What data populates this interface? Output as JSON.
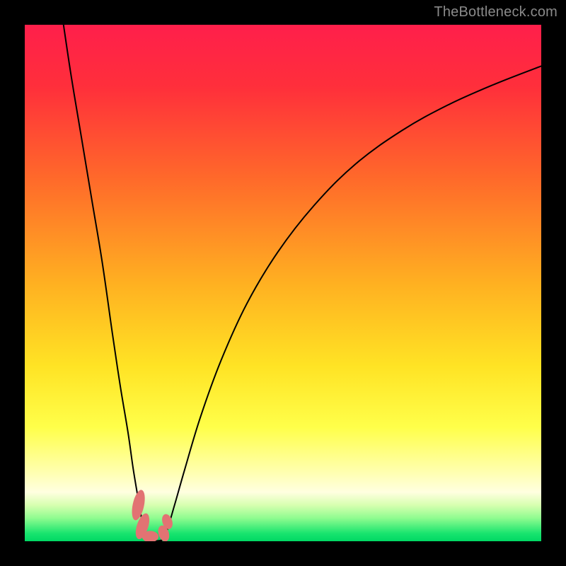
{
  "watermark": "TheBottleneck.com",
  "chart_data": {
    "type": "line",
    "title": "",
    "xlabel": "",
    "ylabel": "",
    "xlim": [
      0,
      100
    ],
    "ylim": [
      0,
      100
    ],
    "gradient_stops": [
      {
        "offset": 0.0,
        "color": "#ff1f4b"
      },
      {
        "offset": 0.12,
        "color": "#ff2f3b"
      },
      {
        "offset": 0.3,
        "color": "#ff6a2a"
      },
      {
        "offset": 0.5,
        "color": "#ffb021"
      },
      {
        "offset": 0.66,
        "color": "#ffe324"
      },
      {
        "offset": 0.78,
        "color": "#ffff4a"
      },
      {
        "offset": 0.86,
        "color": "#ffffa8"
      },
      {
        "offset": 0.905,
        "color": "#ffffe0"
      },
      {
        "offset": 0.93,
        "color": "#d7ffb0"
      },
      {
        "offset": 0.955,
        "color": "#90fc90"
      },
      {
        "offset": 0.985,
        "color": "#18e46e"
      },
      {
        "offset": 1.0,
        "color": "#00d864"
      }
    ],
    "series": [
      {
        "name": "left-curve",
        "x": [
          7.5,
          9,
          11,
          13,
          15,
          17,
          18.5,
          20,
          21,
          22,
          22.7,
          23.2,
          23.6,
          23.8
        ],
        "y": [
          100,
          90,
          78,
          66,
          54,
          40,
          30,
          21,
          14,
          8,
          4,
          2,
          0.8,
          0.2
        ]
      },
      {
        "name": "right-curve",
        "x": [
          26.5,
          27.5,
          29,
          31,
          34,
          38,
          43,
          49,
          56,
          64,
          73,
          82,
          91,
          100
        ],
        "y": [
          0.2,
          2,
          7,
          14,
          24,
          35,
          46,
          56,
          65,
          73,
          79.5,
          84.5,
          88.5,
          92
        ]
      },
      {
        "name": "valley-floor",
        "x": [
          23.8,
          24.5,
          25.3,
          26.0,
          26.5
        ],
        "y": [
          0.2,
          0.05,
          0.05,
          0.1,
          0.2
        ]
      }
    ],
    "markers": [
      {
        "name": "left-blob-1",
        "cx": 22.0,
        "cy": 7.0,
        "rx": 1.1,
        "ry": 3.0,
        "rot": 12
      },
      {
        "name": "left-blob-2",
        "cx": 22.8,
        "cy": 2.9,
        "rx": 1.1,
        "ry": 2.6,
        "rot": 18
      },
      {
        "name": "left-blob-3",
        "cx": 24.3,
        "cy": 0.9,
        "rx": 1.6,
        "ry": 1.1,
        "rot": 0
      },
      {
        "name": "right-blob-1",
        "cx": 26.9,
        "cy": 1.5,
        "rx": 1.0,
        "ry": 1.6,
        "rot": -18
      },
      {
        "name": "right-blob-2",
        "cx": 27.6,
        "cy": 3.8,
        "rx": 0.95,
        "ry": 1.5,
        "rot": -18
      }
    ],
    "marker_color": "#e27373",
    "curve_color": "#000000",
    "curve_width": 2
  }
}
